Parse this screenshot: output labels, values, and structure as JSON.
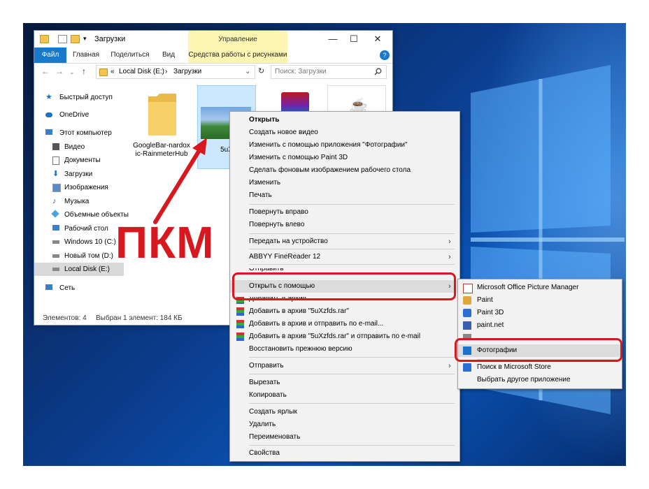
{
  "window": {
    "title": "Загрузки",
    "manage_label": "Управление",
    "controls": {
      "minimize": "—",
      "maximize": "☐",
      "close": "✕"
    }
  },
  "ribbon": {
    "tabs": [
      "Файл",
      "Главная",
      "Поделиться",
      "Вид",
      "Средства работы с рисунками"
    ],
    "help": "?"
  },
  "address": {
    "prefix": "«",
    "parts": [
      "Local Disk (E:)",
      "Загрузки"
    ],
    "separator": "›",
    "search_placeholder": "Поиск: Загрузки"
  },
  "nav": {
    "items": [
      {
        "label": "Быстрый доступ",
        "icon": "star-icon",
        "color": "#1a73c9"
      },
      {
        "label": "OneDrive",
        "icon": "cloud-icon",
        "color": "#1a73c9"
      },
      {
        "label": "Этот компьютер",
        "icon": "computer-icon",
        "color": "#3b7ec9"
      },
      {
        "label": "Видео",
        "icon": "video-icon",
        "color": "#555"
      },
      {
        "label": "Документы",
        "icon": "documents-icon",
        "color": "#777"
      },
      {
        "label": "Загрузки",
        "icon": "download-icon",
        "color": "#1a73c9"
      },
      {
        "label": "Изображения",
        "icon": "images-icon",
        "color": "#5a8bc9"
      },
      {
        "label": "Музыка",
        "icon": "music-icon",
        "color": "#777"
      },
      {
        "label": "Объемные объекты",
        "icon": "3d-objects-icon",
        "color": "#4aa3df"
      },
      {
        "label": "Рабочий стол",
        "icon": "desktop-icon",
        "color": "#3b7ec9"
      },
      {
        "label": "Windows 10 (C:)",
        "icon": "drive-icon",
        "color": "#666"
      },
      {
        "label": "Новый том (D:)",
        "icon": "drive-icon",
        "color": "#666"
      },
      {
        "label": "Local Disk (E:)",
        "icon": "drive-icon",
        "color": "#666"
      },
      {
        "label": "Сеть",
        "icon": "network-icon",
        "color": "#3b7ec9"
      }
    ]
  },
  "files": [
    {
      "name": "GoogleBar-nardoxic-RainmeterHub",
      "icon": "folder-icon"
    },
    {
      "name": "5uX",
      "icon": "image-file-icon"
    },
    {
      "name": "",
      "icon": "winrar-icon"
    },
    {
      "name": "",
      "icon": "java-icon"
    }
  ],
  "status": {
    "count": "Элементов: 4",
    "selected": "Выбран 1 элемент: 184 КБ"
  },
  "context_menu": {
    "items": [
      "Открыть",
      "Создать новое видео",
      "Изменить с помощью приложения \"Фотографии\"",
      "Изменить с помощью Paint 3D",
      "Сделать фоновым изображением рабочего стола",
      "Изменить",
      "Печать",
      "Повернуть вправо",
      "Повернуть влево",
      "Передать на устройство",
      "ABBYY FineReader 12",
      "Отправить",
      "Открыть с помощью",
      "Добавить в архив...",
      "Добавить в архив \"5uXzfds.rar\"",
      "Добавить в архив и отправить по e-mail...",
      "Добавить в архив \"5uXzfds.rar\" и отправить по e-mail",
      "Восстановить прежнюю версию",
      "Отправить",
      "Вырезать",
      "Копировать",
      "Создать ярлык",
      "Удалить",
      "Переименовать",
      "Свойства"
    ],
    "submenu_arrow": "›"
  },
  "open_with_menu": {
    "items": [
      {
        "label": "Microsoft Office Picture Manager",
        "icon": "picture-manager-icon",
        "color": "#c0392b"
      },
      {
        "label": "Paint",
        "icon": "paint-icon",
        "color": "#e0a83a"
      },
      {
        "label": "Paint 3D",
        "icon": "paint3d-icon",
        "color": "#2b6fd6"
      },
      {
        "label": "paint.net",
        "icon": "paintnet-icon",
        "color": "#3a5fb0"
      },
      {
        "label": "",
        "icon": "app-icon",
        "color": "#888"
      },
      {
        "label": "Фотографии",
        "icon": "photos-icon",
        "color": "#1a73c9"
      },
      {
        "label": "Поиск в Microsoft Store",
        "icon": "store-icon",
        "color": "#2b6fd6"
      },
      {
        "label": "Выбрать другое приложение",
        "icon": "",
        "color": ""
      }
    ]
  },
  "annotation": {
    "text": "ПКМ",
    "color": "#d7191f"
  },
  "colors": {
    "accent": "#1979ca",
    "highlight": "#d7191f",
    "selection": "#cce8ff"
  }
}
